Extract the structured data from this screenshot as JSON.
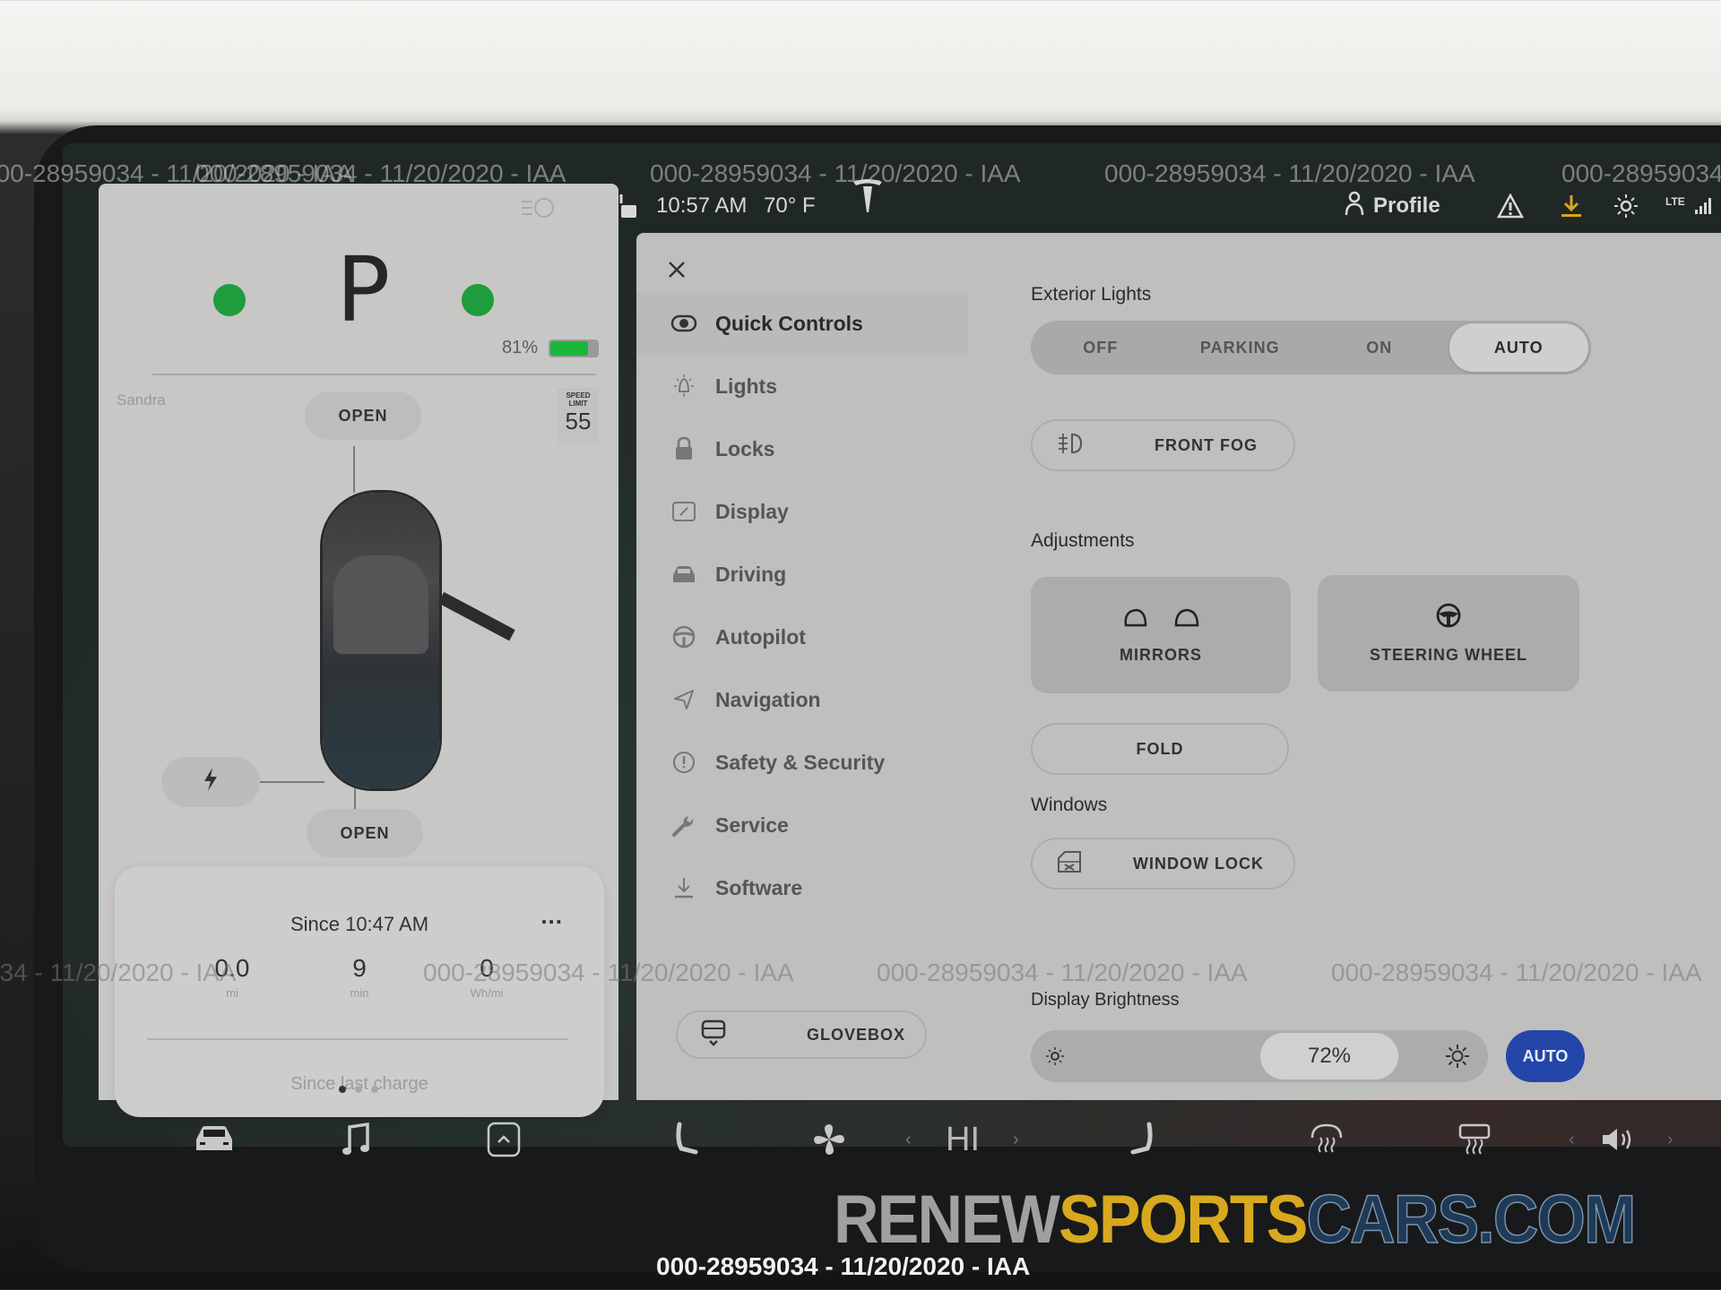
{
  "status_bar": {
    "time": "10:57 AM",
    "temperature": "70° F",
    "profile_label": "Profile",
    "network": "LTE",
    "icons": [
      "unlock-icon",
      "tesla-logo-icon",
      "person-icon",
      "warning-icon",
      "download-icon",
      "dashcam-icon",
      "signal-icon"
    ]
  },
  "car_panel": {
    "gear": "P",
    "battery_percent_label": "81%",
    "battery_level": 0.81,
    "driver_name": "Sandra",
    "frunk_label": "OPEN",
    "trunk_label": "OPEN",
    "speed_limit_label": "SPEED LIMIT",
    "speed_limit_value": "55",
    "charge_icon": "lightning-icon",
    "trip": {
      "title": "Since 10:47 AM",
      "more": "...",
      "stats": [
        {
          "value": "0.0",
          "unit": "mi"
        },
        {
          "value": "9",
          "unit": "min"
        },
        {
          "value": "0",
          "unit": "Wh/mi"
        }
      ],
      "footer": "Since last charge"
    },
    "pager": {
      "count": 3,
      "active": 0
    }
  },
  "controls": {
    "nav": [
      {
        "label": "Quick Controls",
        "icon": "toggle-icon",
        "active": true
      },
      {
        "label": "Lights",
        "icon": "bulb-icon"
      },
      {
        "label": "Locks",
        "icon": "lock-icon"
      },
      {
        "label": "Display",
        "icon": "display-icon"
      },
      {
        "label": "Driving",
        "icon": "car-icon"
      },
      {
        "label": "Autopilot",
        "icon": "steering-wheel-icon"
      },
      {
        "label": "Navigation",
        "icon": "navigation-arrow-icon"
      },
      {
        "label": "Safety & Security",
        "icon": "alert-circle-icon"
      },
      {
        "label": "Service",
        "icon": "wrench-icon"
      },
      {
        "label": "Software",
        "icon": "download-icon"
      }
    ],
    "glovebox_label": "GLOVEBOX",
    "exterior_lights": {
      "title": "Exterior Lights",
      "options": [
        "OFF",
        "PARKING",
        "ON",
        "AUTO"
      ],
      "selected": "AUTO",
      "front_fog_label": "FRONT FOG"
    },
    "adjustments": {
      "title": "Adjustments",
      "mirrors_label": "MIRRORS",
      "steering_label": "STEERING WHEEL",
      "fold_label": "FOLD"
    },
    "windows": {
      "title": "Windows",
      "window_lock_label": "WINDOW LOCK"
    },
    "display_brightness": {
      "title": "Display Brightness",
      "value_label": "72%",
      "value": 0.72,
      "auto_label": "AUTO",
      "auto_color": "#2346a8"
    }
  },
  "dock": {
    "items": [
      "car-icon",
      "music-icon",
      "app-launcher-icon",
      "driver-seat-heat-icon",
      "fan-icon",
      "climate-temp",
      "passenger-seat-heat-icon",
      "front-defrost-icon",
      "rear-defrost-icon",
      "volume-icon"
    ],
    "climate_label": "HI"
  },
  "watermark": {
    "text": "000-28959034 - 11/20/2020 - IAA",
    "brand_part1": "RENEW",
    "brand_part2": "SPORTS",
    "brand_part3": "CARS.COM",
    "brand_colors": {
      "part1": "#9ea0a1",
      "part2": "#d8a91e",
      "part3": "#1f3a56"
    }
  }
}
